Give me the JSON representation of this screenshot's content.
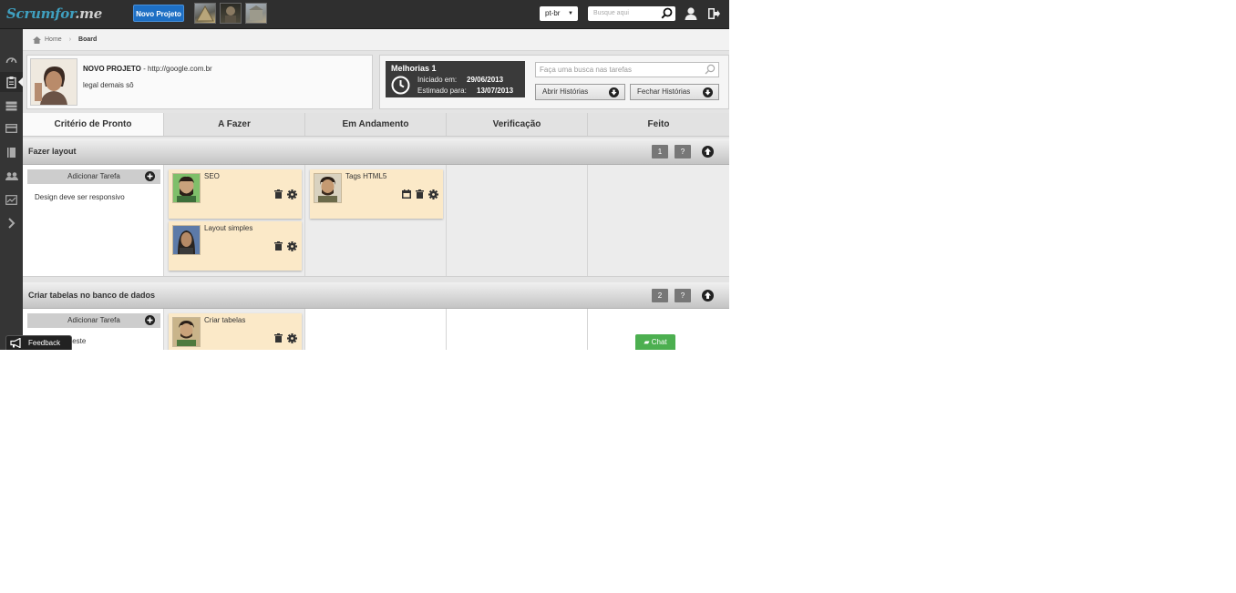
{
  "brand": {
    "logo_main": "Scrumfor",
    "logo_suffix": ".me"
  },
  "topbar": {
    "new_project_label": "Novo Projeto",
    "language": "pt-br",
    "search_placeholder": "Busque aqui",
    "icons": [
      "user-icon",
      "logout-icon"
    ]
  },
  "sidebar": {
    "items": [
      "dashboard-icon",
      "board-icon",
      "stories-icon",
      "card-icon",
      "book-icon",
      "team-icon",
      "chart-icon",
      "expand-icon"
    ],
    "active_index": 1
  },
  "breadcrumb": {
    "home": "Home",
    "current": "Board"
  },
  "project": {
    "name": "NOVO PROJETO",
    "separator": " - ",
    "url": "http://google.com.br",
    "description": "legal demais sô"
  },
  "sprint": {
    "title": "Melhorias 1",
    "started_label": "Iniciado em:",
    "started_date": "29/06/2013",
    "estimated_label": "Estimado para:",
    "estimated_date": "13/07/2013",
    "search_placeholder": "Faça uma busca nas tarefas",
    "open_stories_label": "Abrir Histórias",
    "close_stories_label": "Fechar Histórias"
  },
  "columns": [
    "Critério de Pronto",
    "A Fazer",
    "Em Andamento",
    "Verificação",
    "Feito"
  ],
  "add_task_label": "Adicionar Tarefa",
  "stories": [
    {
      "title": "Fazer layout",
      "number": "1",
      "help": "?",
      "criteria": "Design deve ser responsivo",
      "todo": [
        {
          "title": "SEO",
          "actions": [
            "trash-icon",
            "gear-icon"
          ]
        },
        {
          "title": "Layout simples",
          "actions": [
            "trash-icon",
            "gear-icon"
          ]
        }
      ],
      "in_progress": [
        {
          "title": "Tags HTML5",
          "actions": [
            "calendar-icon",
            "trash-icon",
            "gear-icon"
          ]
        }
      ]
    },
    {
      "title": "Criar tabelas no banco de dados",
      "number": "2",
      "help": "?",
      "criteria": "teste",
      "todo": [
        {
          "title": "Criar tabelas",
          "actions": [
            "trash-icon",
            "gear-icon"
          ]
        }
      ]
    }
  ],
  "feedback_label": "Feedback",
  "chat_label": "Chat",
  "colors": {
    "topbar": "#2f2f2f",
    "brand_blue": "#1d6fc4",
    "card": "#fbe9c8",
    "chat_green": "#4caf50"
  }
}
